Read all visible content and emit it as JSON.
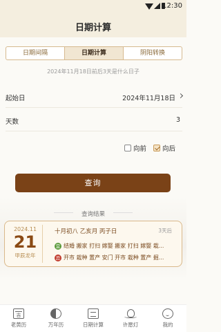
{
  "status": {
    "time": "12:30"
  },
  "header": {
    "title": "日期计算"
  },
  "tabs": [
    {
      "label": "日期间隔",
      "active": false
    },
    {
      "label": "日期计算",
      "active": true
    },
    {
      "label": "阴阳转换",
      "active": false
    }
  ],
  "subtitle": "2024年11月18日前后3天是什么日子",
  "form": {
    "start_label": "起始日",
    "start_value": "2024年11月18日",
    "days_label": "天数",
    "days_value": "3",
    "before_label": "向前",
    "before_checked": false,
    "after_label": "向后",
    "after_checked": true
  },
  "query_button": "查询",
  "result": {
    "heading": "查询结果",
    "year_month": "2024.11",
    "day": "21",
    "ganzhi_year": "甲辰龙年",
    "lunar": "十月初八  乙亥月  丙子日",
    "offset": "3天后",
    "yi_badge": "宜",
    "yi_text": "结婚 搬家 打扫 嫁娶 搬家 打扫 嫁娶 栽...",
    "ji_badge": "忌",
    "ji_text": "开市 栽种 置产 安门 开市 栽种 置产 掘..."
  },
  "tabbar": [
    {
      "label": "老黄历",
      "icon": "calendar-icon"
    },
    {
      "label": "万年历",
      "icon": "yinyang-icon"
    },
    {
      "label": "日期计算",
      "icon": "grid-calendar-icon"
    },
    {
      "label": "许愿灯",
      "icon": "lotus-lamp-icon"
    },
    {
      "label": "我的",
      "icon": "face-icon"
    }
  ],
  "colors": {
    "primary": "#7a4217",
    "header_bg": "#f4eedf",
    "accent_border": "#d9b88a",
    "yi": "#5a9a3a",
    "ji": "#c0392b"
  }
}
